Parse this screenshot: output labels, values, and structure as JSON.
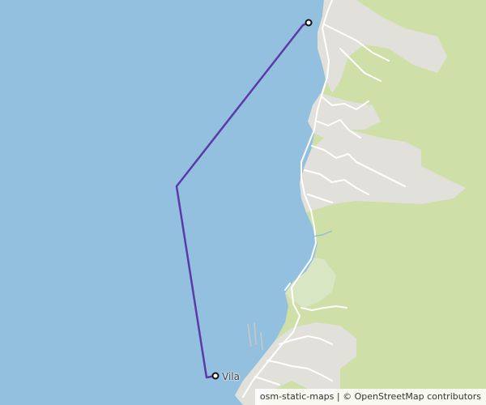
{
  "map": {
    "place_label": "Vila",
    "attribution": "osm-static-maps | © OpenStreetMap contributors",
    "colors": {
      "water": "#94c0e0",
      "forest": "#cfdfa8",
      "urban": "#e2e0da",
      "scrub": "#d9e6c4",
      "road": "#ffffff",
      "route": "#5b3aa8"
    },
    "route": {
      "start_marker": "route-start-marker",
      "end_marker": "route-end-marker"
    }
  }
}
